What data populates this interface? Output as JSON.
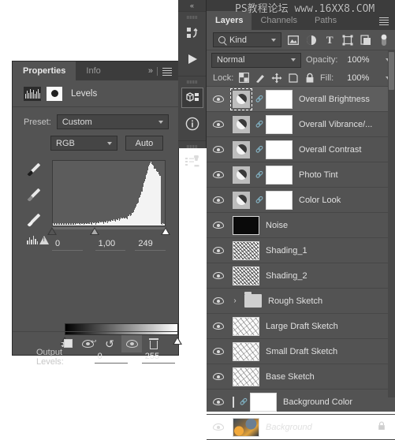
{
  "properties_panel": {
    "tabs": [
      {
        "label": "Properties",
        "active": true
      },
      {
        "label": "Info",
        "active": false
      }
    ],
    "collapse_icon": "»",
    "menu_icon": "panel-menu-icon",
    "adjustment": {
      "title": "Levels",
      "icon": "levels-histogram-icon",
      "mask_icon": "layer-mask-icon"
    },
    "preset": {
      "label": "Preset:",
      "value": "Custom"
    },
    "channel": {
      "value": "RGB"
    },
    "auto_button": "Auto",
    "eyedroppers": [
      {
        "name": "eyedropper-black"
      },
      {
        "name": "eyedropper-gray"
      },
      {
        "name": "eyedropper-white"
      }
    ],
    "input_levels": {
      "black": "0",
      "gamma": "1,00",
      "white": "249"
    },
    "output_levels": {
      "label": "Output Levels:",
      "black": "0",
      "white": "255"
    },
    "footer_buttons": [
      {
        "name": "clip-to-layer-button",
        "icon": "clip-icon"
      },
      {
        "name": "view-previous-state-button",
        "icon": "eye-previous-icon"
      },
      {
        "name": "reset-adjustment-button",
        "icon": "reset-icon"
      },
      {
        "name": "toggle-visibility-button",
        "icon": "eye-icon",
        "active": true
      },
      {
        "name": "delete-adjustment-button",
        "icon": "trash-icon"
      }
    ]
  },
  "icon_rail": {
    "collapse_label": "«",
    "buttons": [
      {
        "name": "rail-history-icon",
        "glyph": "history-actions-icon"
      },
      {
        "name": "rail-play-icon",
        "glyph": "play-icon"
      },
      {
        "name": "rail-properties-icon",
        "glyph": "properties-3d-icon",
        "active": true
      },
      {
        "name": "rail-info-icon",
        "glyph": "info-icon"
      },
      {
        "name": "rail-layer-comps-icon",
        "glyph": "layer-comps-icon"
      }
    ]
  },
  "layers_panel": {
    "watermark": "PS教程论坛 www.16XX8.COM",
    "tabs": [
      {
        "label": "Layers",
        "active": true
      },
      {
        "label": "Channels",
        "active": false
      },
      {
        "label": "Paths",
        "active": false
      }
    ],
    "filter": {
      "kind_label": "Kind",
      "icons": [
        {
          "name": "filter-pixel-icon"
        },
        {
          "name": "filter-adjustment-icon"
        },
        {
          "name": "filter-type-icon"
        },
        {
          "name": "filter-shape-icon"
        },
        {
          "name": "filter-smartobject-icon"
        },
        {
          "name": "filter-toggle-switch"
        }
      ]
    },
    "blend_mode": "Normal",
    "opacity": {
      "label": "Opacity:",
      "value": "100%"
    },
    "fill": {
      "label": "Fill:",
      "value": "100%"
    },
    "lock": {
      "label": "Lock:",
      "icons": [
        {
          "name": "lock-transparency-icon"
        },
        {
          "name": "lock-image-icon"
        },
        {
          "name": "lock-position-icon"
        },
        {
          "name": "lock-artboard-icon"
        },
        {
          "name": "lock-all-icon"
        }
      ]
    },
    "layers": [
      {
        "name": "Overall Brightness",
        "type": "adjustment",
        "visible": true,
        "selected": true,
        "has_mask": true,
        "linked": true
      },
      {
        "name": "Overall Vibrance/...",
        "type": "adjustment",
        "visible": true,
        "selected": false,
        "has_mask": true,
        "linked": true
      },
      {
        "name": "Overall Contrast",
        "type": "adjustment",
        "visible": true,
        "selected": false,
        "has_mask": true,
        "linked": true
      },
      {
        "name": "Photo Tint",
        "type": "adjustment",
        "visible": true,
        "selected": false,
        "has_mask": true,
        "linked": true
      },
      {
        "name": "Color Look",
        "type": "adjustment",
        "visible": true,
        "selected": false,
        "has_mask": true,
        "linked": true
      },
      {
        "name": "Noise",
        "type": "noise",
        "visible": true,
        "selected": false
      },
      {
        "name": "Shading_1",
        "type": "sketch",
        "visible": true,
        "selected": false
      },
      {
        "name": "Shading_2",
        "type": "sketch",
        "visible": true,
        "selected": false
      },
      {
        "name": "Rough Sketch",
        "type": "group",
        "visible": true,
        "selected": false
      },
      {
        "name": "Large Draft Sketch",
        "type": "sketch-light",
        "visible": true,
        "selected": false
      },
      {
        "name": "Small Draft Sketch",
        "type": "sketch-light",
        "visible": true,
        "selected": false
      },
      {
        "name": "Base Sketch",
        "type": "sketch-light",
        "visible": true,
        "selected": false
      },
      {
        "name": "Background Color",
        "type": "solid-color",
        "visible": true,
        "selected": false,
        "has_mask": true,
        "linked": true,
        "color": "#dfcda4"
      },
      {
        "name": "Background",
        "type": "photo",
        "visible": true,
        "selected": false,
        "locked": true,
        "italic": true
      }
    ]
  },
  "colors": {
    "panel_bg": "#535353",
    "tabbar_bg": "#3c3c3c",
    "row_selected": "#5e5e5e",
    "text": "#e0e0e0",
    "page_bg": "#ffffff"
  }
}
